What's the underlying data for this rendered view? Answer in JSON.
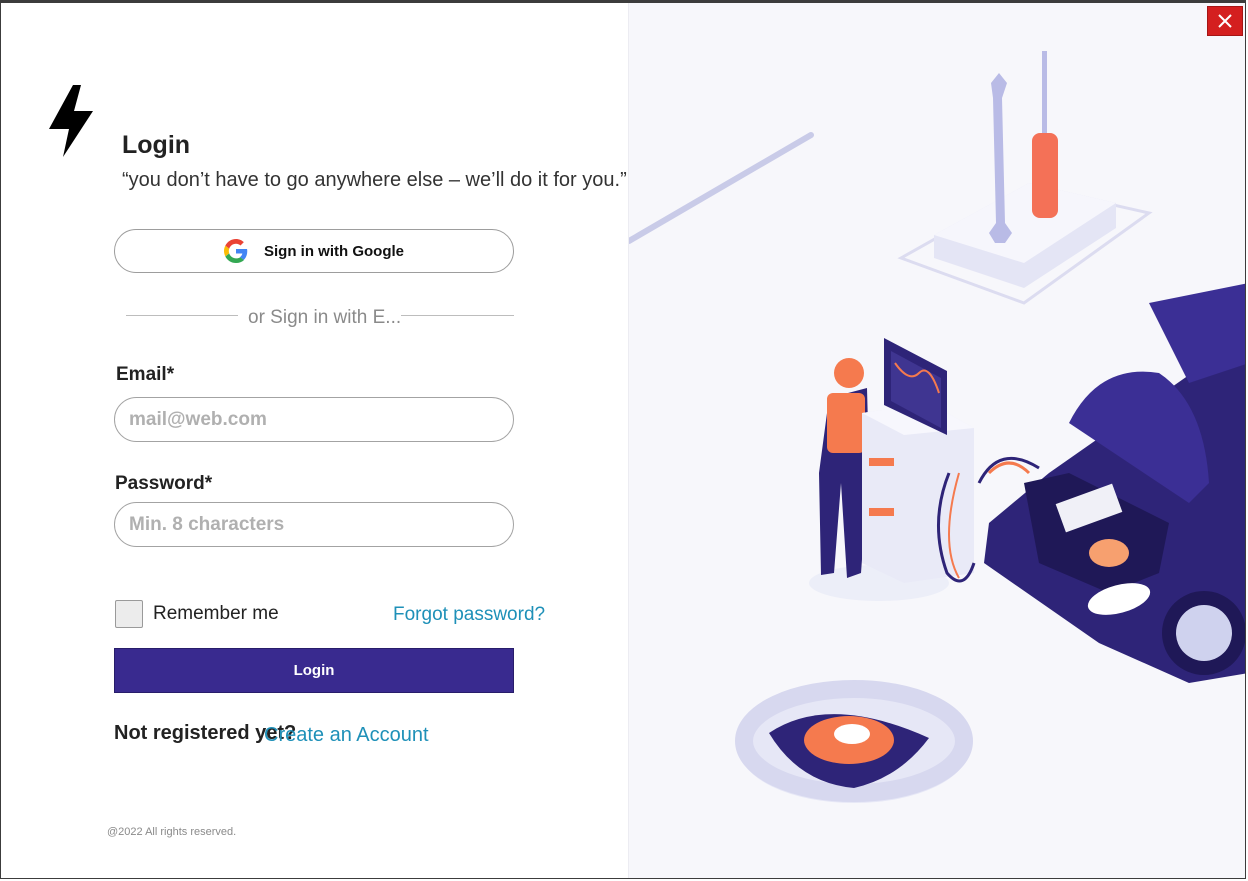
{
  "login": {
    "title": "Login",
    "tagline": "“you don’t have to go anywhere else – we’ll do it for you.”",
    "google_button_label": "Sign in with Google",
    "divider_text": "or Sign in with E...",
    "email": {
      "label": "Email*",
      "placeholder": "mail@web.com",
      "value": ""
    },
    "password": {
      "label": "Password*",
      "placeholder": "Min. 8 characters",
      "value": ""
    },
    "remember_me_label": "Remember me",
    "remember_me_checked": false,
    "forgot_password_label": "Forgot password?",
    "login_button_label": "Login",
    "not_registered_text": "Not registered yet?",
    "create_account_label": "Create an Account",
    "footer": "@2022 All rights reserved."
  },
  "window": {
    "close_icon": "close-icon"
  },
  "icons": {
    "logo": "lightning-bolt-icon",
    "google": "google-g-icon"
  },
  "colors": {
    "primary": "#392a8f",
    "link": "#1e90b8",
    "close": "#d41f1f",
    "illustration_navy": "#2e2478",
    "illustration_orange": "#f57a4e"
  }
}
